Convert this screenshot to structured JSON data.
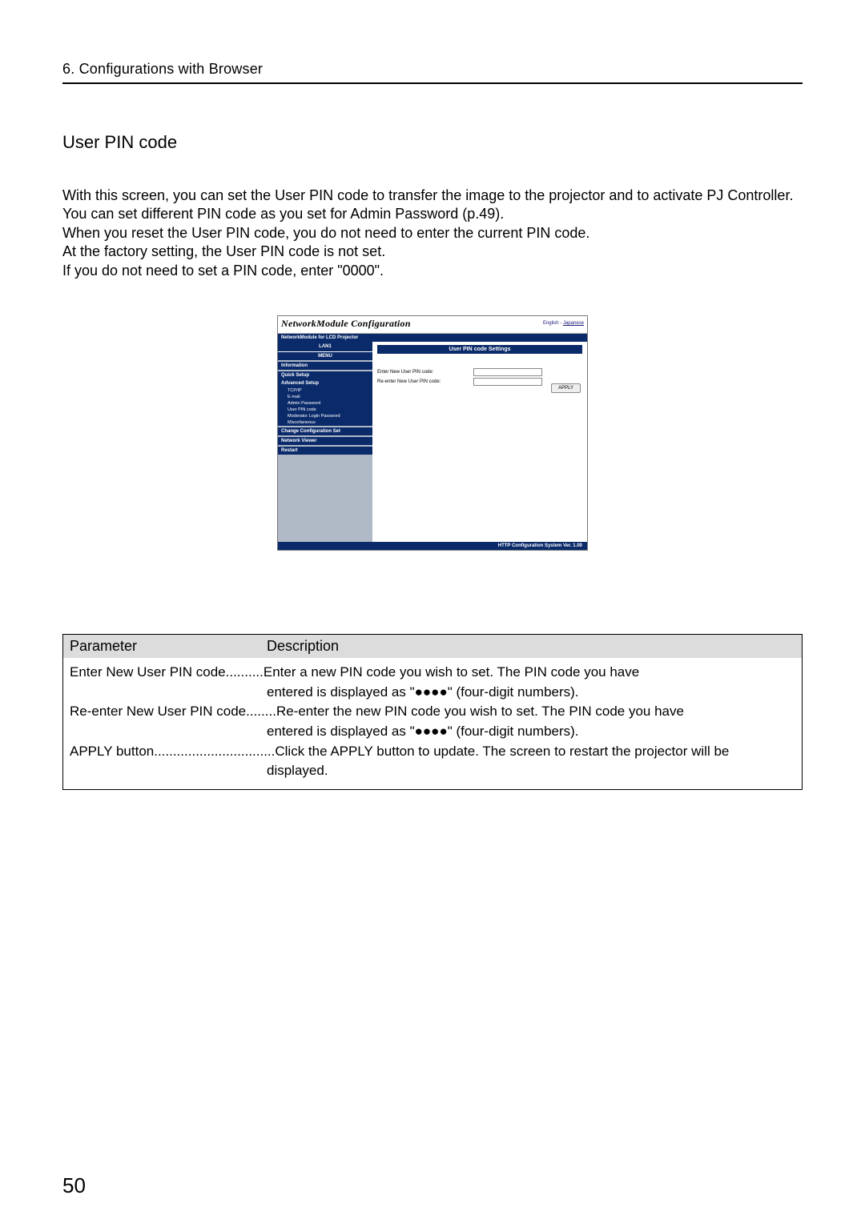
{
  "chapter": "6. Configurations with Browser",
  "section_title": "User PIN code",
  "body": {
    "p1": "With this screen, you can set the User PIN code to transfer the image to the projector and to activate PJ Controller.",
    "p2": "You can set different PIN code as you set for Admin Password (p.49).",
    "p3": "When you reset the User PIN code, you do not need to enter the current PIN code.",
    "p4": "At the factory setting, the User PIN code is not set.",
    "p5": "If you do not need to set a PIN code, enter \"0000\"."
  },
  "figure": {
    "title": "NetworkModule Configuration",
    "lang_en": "English",
    "lang_sep": " - ",
    "lang_jp": "Japanese",
    "subtitle": "NetworkModule for LCD Projector",
    "side_top": "LAN1",
    "menu_label": "MENU",
    "menu": {
      "information": "Information",
      "quick_setup": "Quick Setup",
      "advanced_setup": "Advanced Setup",
      "tcpip": "TCP/IP",
      "email": "E-mail",
      "admin_pw": "Admin Password",
      "user_pin": "User PIN code",
      "mod_login": "Moderator Login Password",
      "misc": "Miscellaneous",
      "change_config": "Change Configuration Set",
      "net_viewer": "Network Viewer",
      "restart": "Restart"
    },
    "panel_title": "User PIN code Settings",
    "form": {
      "enter_label": "Enter New User PIN code:",
      "reenter_label": "Re-enter New User PIN code:",
      "apply": "APPLY"
    },
    "footer": "HTTP Configuration System Ver. 1.00"
  },
  "param_table": {
    "header": {
      "col1": "Parameter",
      "col2": "Description"
    },
    "rows": [
      {
        "label": "Enter New User PIN code ",
        "dots": "..........",
        "desc": "Enter a new PIN code you wish to set. The PIN code you have",
        "cont": "entered is displayed as \"●●●●\" (four-digit numbers)."
      },
      {
        "label": "Re-enter New User PIN code",
        "dots": "........",
        "desc": "Re-enter the new PIN code you wish to set. The PIN code you have",
        "cont": "entered is displayed as \"●●●●\" (four-digit numbers)."
      },
      {
        "label": "APPLY button",
        "dots": "................................",
        "desc": "Click the APPLY button to update. The screen to restart the projector will be",
        "cont": "displayed."
      }
    ]
  },
  "page_number": "50"
}
